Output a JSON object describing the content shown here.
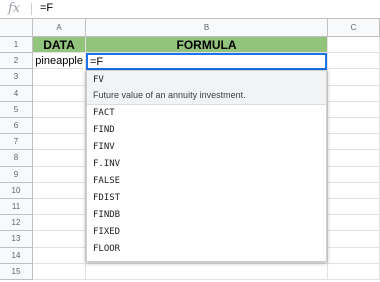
{
  "formula_bar": {
    "icon": "fx-icon",
    "value": "=F"
  },
  "columns": [
    "A",
    "B",
    "C"
  ],
  "rows": [
    "1",
    "2",
    "3",
    "4",
    "5",
    "6",
    "7",
    "8",
    "9",
    "10",
    "11",
    "12",
    "13",
    "14",
    "15"
  ],
  "cells": {
    "A1": "DATA",
    "B1": "FORMULA",
    "A2": "pineapple",
    "B2": "=F"
  },
  "colors": {
    "header_fill": "#93c47d",
    "selection": "#1a73e8"
  },
  "autocomplete": {
    "selected": {
      "name": "FV",
      "description": "Future value of an annuity investment."
    },
    "items": [
      "FACT",
      "FIND",
      "FINV",
      "F.INV",
      "FALSE",
      "FDIST",
      "FINDB",
      "FIXED",
      "FLOOR"
    ]
  }
}
